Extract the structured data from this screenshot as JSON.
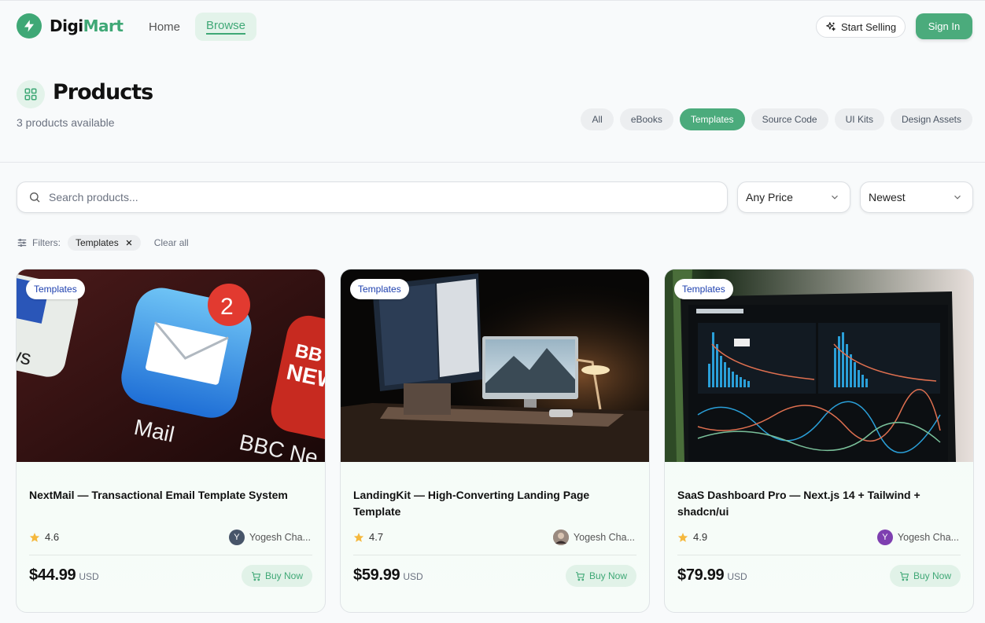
{
  "brand": {
    "name_part1": "Digi",
    "name_part2": "Mart",
    "accent": "#4bab7c",
    "icon": "bolt-icon"
  },
  "nav": {
    "home": "Home",
    "browse": "Browse",
    "active": "Browse"
  },
  "header_actions": {
    "start_selling": "Start Selling",
    "sign_in": "Sign In"
  },
  "page": {
    "title": "Products",
    "subtitle": "3 products available",
    "icon": "grid-icon"
  },
  "categories": [
    "All",
    "eBooks",
    "Templates",
    "Source Code",
    "UI Kits",
    "Design Assets"
  ],
  "active_category": "Templates",
  "search": {
    "placeholder": "Search products...",
    "value": ""
  },
  "price_filter": {
    "selected": "Any Price"
  },
  "sort": {
    "selected": "Newest"
  },
  "filters": {
    "label": "Filters:",
    "active": [
      "Templates"
    ],
    "clear_all": "Clear all"
  },
  "products": [
    {
      "badge": "Templates",
      "title": "NextMail — Transactional Email Template System",
      "rating": "4.6",
      "author": "Yogesh Cha...",
      "author_initial": "Y",
      "author_color": "#475569",
      "price": "$44.99",
      "currency": "USD",
      "buy_label": "Buy Now"
    },
    {
      "badge": "Templates",
      "title": "LandingKit — High-Converting Landing Page Template",
      "rating": "4.7",
      "author": "Yogesh Cha...",
      "author_initial": "",
      "author_color": "#8a7a70",
      "price": "$59.99",
      "currency": "USD",
      "buy_label": "Buy Now"
    },
    {
      "badge": "Templates",
      "title": "SaaS Dashboard Pro — Next.js 14 + Tailwind + shadcn/ui",
      "rating": "4.9",
      "author": "Yogesh Cha...",
      "author_initial": "Y",
      "author_color": "#7e3fb0",
      "price": "$79.99",
      "currency": "USD",
      "buy_label": "Buy Now"
    }
  ]
}
